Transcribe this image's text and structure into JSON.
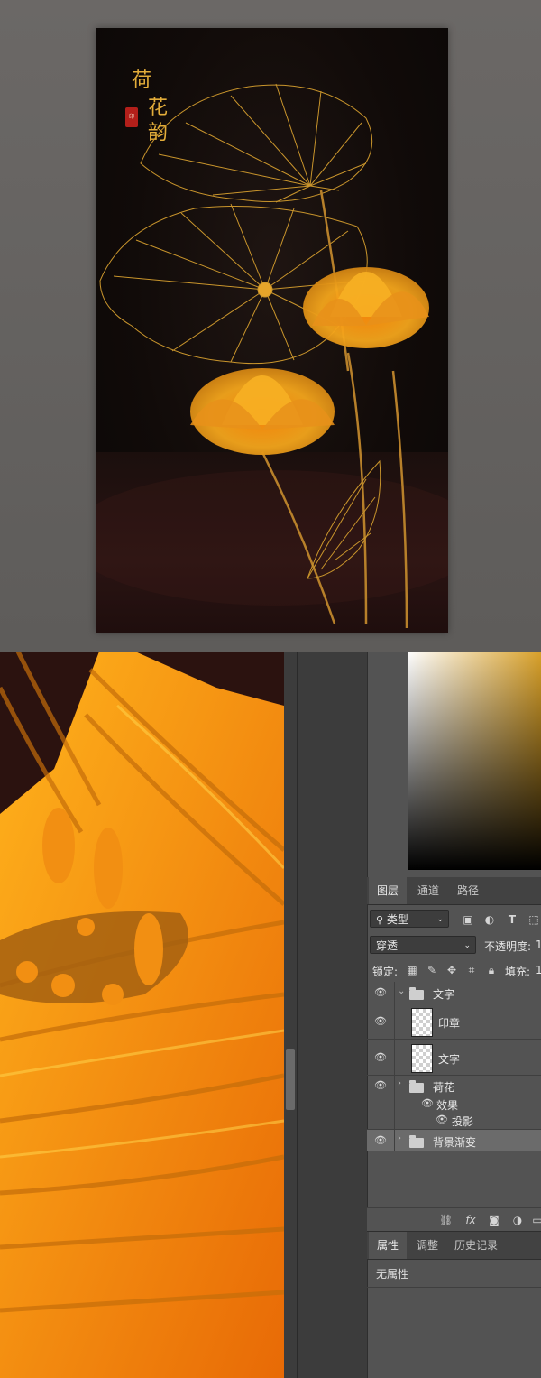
{
  "poster": {
    "title_chars": [
      "荷",
      "花",
      "韵"
    ],
    "seal_text": "印",
    "colors": {
      "gold": "#e3ad3a",
      "background": "#110b09"
    }
  },
  "layers_panel": {
    "tabs": [
      "图层",
      "通道",
      "路径"
    ],
    "filter_kind": "类型",
    "blend_mode": "穿透",
    "opacity_label": "不透明度:",
    "opacity_value": "1",
    "lock_label": "锁定:",
    "fill_label": "填充:",
    "fill_value": "1",
    "layers": [
      {
        "name": "文字",
        "type": "group",
        "expanded": true
      },
      {
        "name": "印章",
        "type": "layer"
      },
      {
        "name": "文字",
        "type": "layer"
      },
      {
        "name": "荷花",
        "type": "group",
        "expanded": false
      },
      {
        "name": "效果",
        "type": "effects"
      },
      {
        "name": "投影",
        "type": "effect"
      },
      {
        "name": "背景渐变",
        "type": "group",
        "expanded": false
      }
    ],
    "footer_icons": [
      "link-icon",
      "fx-icon",
      "mask-icon",
      "adjustment-icon",
      "new-layer-icon"
    ]
  },
  "properties_panel": {
    "tabs": [
      "属性",
      "调整",
      "历史记录"
    ],
    "content": "无属性"
  }
}
